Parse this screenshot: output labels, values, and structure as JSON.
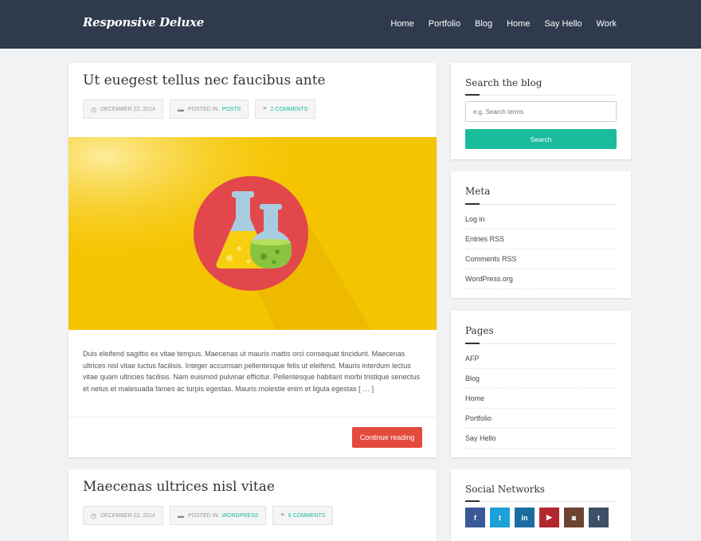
{
  "site": {
    "logo": "Responsive Deluxe",
    "nav": [
      "Home",
      "Portfolio",
      "Blog",
      "Home",
      "Say Hello",
      "Work"
    ]
  },
  "posts": [
    {
      "title": "Ut euegest tellus nec faucibus ante",
      "date": "DECEMBER 22, 2014",
      "posted_in_label": "POSTED IN:",
      "category": "POSTS",
      "comments": "2 COMMENTS",
      "excerpt": "Duis eleifend sagittis ex vitae tempus. Maecenas ut mauris mattis orci consequat tincidunt. Maecenas ultrices nisl vitae luctus facilisis. Integer accumsan pellentesque felis ut eleifend. Mauris interdum lectus vitae quam ultricies facilisis. Nam euismod pulvinar efficitur. Pellentesque habitant morbi tristique senectus et netus et malesuada fames ac turpis egestas. Mauris molestie enim et ligula egestas [ … ]",
      "continue_label": "Continue reading"
    },
    {
      "title": "Maecenas ultrices nisl vitae",
      "date": "DECEMBER 22, 2014",
      "posted_in_label": "POSTED IN:",
      "category": "WORDPRESS",
      "comments": "6 COMMENTS"
    }
  ],
  "sidebar": {
    "search": {
      "title": "Search the blog",
      "placeholder": "e.g. Search terms",
      "button": "Search"
    },
    "meta": {
      "title": "Meta",
      "items": [
        "Log in",
        "Entries RSS",
        "Comments RSS",
        "WordPress.org"
      ]
    },
    "pages": {
      "title": "Pages",
      "items": [
        "AFP",
        "Blog",
        "Home",
        "Portfolio",
        "Say Hello"
      ]
    },
    "social": {
      "title": "Social Networks",
      "items": [
        {
          "name": "facebook-icon",
          "glyph": "f",
          "color": "#3b5998"
        },
        {
          "name": "twitter-icon",
          "glyph": "t",
          "color": "#1da1d8"
        },
        {
          "name": "linkedin-icon",
          "glyph": "in",
          "color": "#1c6d9f"
        },
        {
          "name": "youtube-icon",
          "glyph": "▶",
          "color": "#b3282d"
        },
        {
          "name": "instagram-icon",
          "glyph": "◙",
          "color": "#6d4433"
        },
        {
          "name": "tumblr-icon",
          "glyph": "t",
          "color": "#3d5068"
        }
      ]
    }
  },
  "colors": {
    "header": "#2f3b4c",
    "accent": "#1abc9c",
    "button_red": "#e44a3e",
    "hero": "#f5c400"
  }
}
